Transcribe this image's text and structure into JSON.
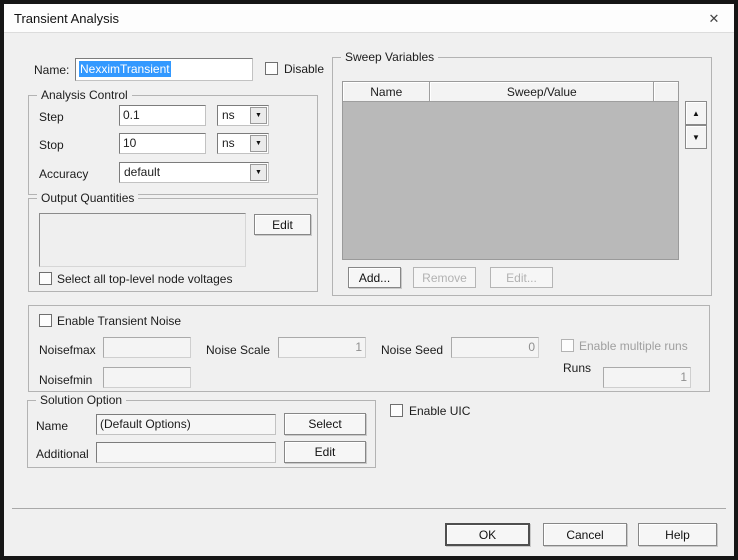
{
  "window": {
    "title": "Transient Analysis"
  },
  "icons": {
    "close": "✕",
    "dropdown": "▼",
    "up": "▲",
    "down": "▼"
  },
  "colors": {
    "selection": "#3399ff",
    "table_body": "#b9b9b9",
    "dialog_bg": "#f0f0f0"
  },
  "name_row": {
    "label": "Name:",
    "value": "NexximTransient",
    "disable_label": "Disable"
  },
  "analysis_control": {
    "legend": "Analysis Control",
    "step": {
      "label": "Step",
      "value": "0.1",
      "unit": "ns"
    },
    "stop": {
      "label": "Stop",
      "value": "10",
      "unit": "ns"
    },
    "accuracy": {
      "label": "Accuracy",
      "value": "default"
    }
  },
  "output_quantities": {
    "legend": "Output Quantities",
    "list_value": "",
    "edit_label": "Edit",
    "checkbox_label": "Select all top-level node voltages"
  },
  "sweep_variables": {
    "legend": "Sweep Variables",
    "columns": [
      "Name",
      "Sweep/Value",
      ""
    ],
    "rows": [],
    "add_label": "Add...",
    "remove_label": "Remove",
    "edit_label": "Edit..."
  },
  "noise": {
    "enable_label": "Enable Transient Noise",
    "noisefmax": {
      "label": "Noisefmax",
      "value": ""
    },
    "noisefmin": {
      "label": "Noisefmin",
      "value": ""
    },
    "noise_scale": {
      "label": "Noise Scale",
      "value": "1"
    },
    "noise_seed": {
      "label": "Noise Seed",
      "value": "0"
    },
    "multiple_runs_label": "Enable multiple runs",
    "runs": {
      "label": "Runs",
      "value": "1"
    }
  },
  "solution_option": {
    "legend": "Solution Option",
    "name": {
      "label": "Name",
      "value": "(Default Options)",
      "button": "Select"
    },
    "additional": {
      "label": "Additional",
      "value": "",
      "button": "Edit"
    }
  },
  "enable_uic_label": "Enable UIC",
  "footer": {
    "ok": "OK",
    "cancel": "Cancel",
    "help": "Help"
  }
}
